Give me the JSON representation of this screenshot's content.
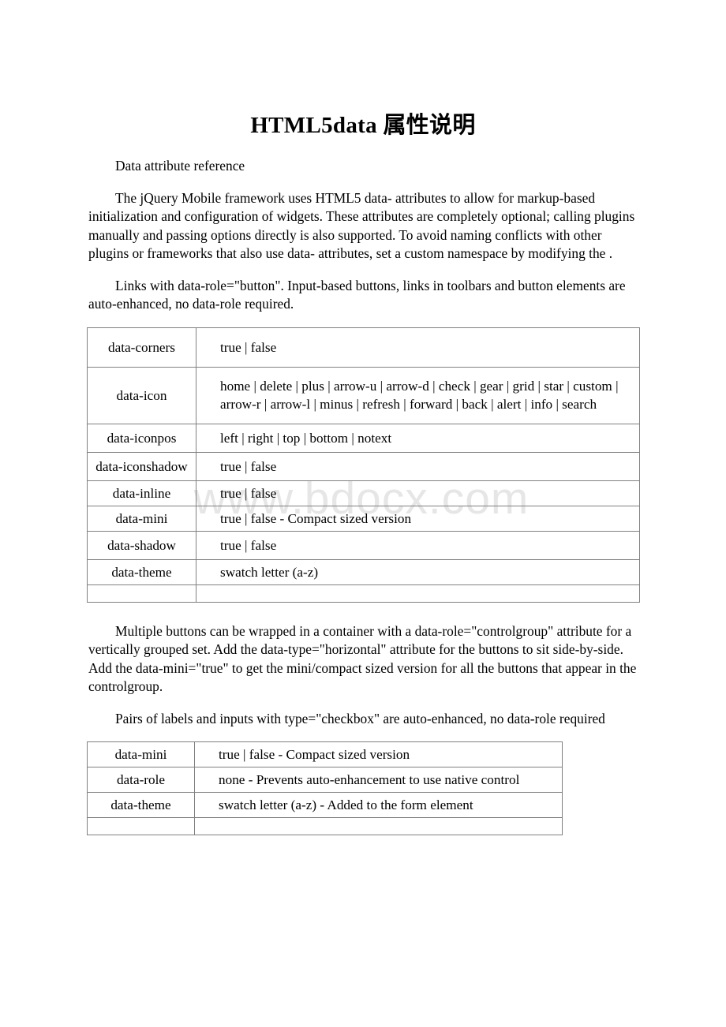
{
  "document": {
    "title": "HTML5data 属性说明",
    "watermark": "www.bdocx.com"
  },
  "sections": {
    "heading_ref": "Data attribute reference",
    "intro_paragraph": "The jQuery Mobile framework uses HTML5 data- attributes to allow for markup-based initialization and configuration of widgets. These attributes are completely optional; calling plugins manually and passing options directly is also supported. To avoid naming conflicts with other plugins or frameworks that also use data- attributes, set a custom namespace by modifying the .",
    "buttons_paragraph": "Links with data-role=\"button\". Input-based buttons, links in toolbars and button elements are auto-enhanced, no data-role required.",
    "controlgroup_paragraph": "Multiple buttons can be wrapped in a container with a data-role=\"controlgroup\" attribute for a vertically grouped set. Add the data-type=\"horizontal\" attribute for the buttons to sit side-by-side. Add the data-mini=\"true\" to get the mini/compact sized version for all the buttons that appear in the controlgroup.",
    "checkbox_paragraph": "Pairs of labels and inputs with type=\"checkbox\" are auto-enhanced, no data-role required"
  },
  "button_table": {
    "rows": [
      {
        "key": "data-corners",
        "value": "true | false"
      },
      {
        "key": "data-icon",
        "value": "home | delete | plus | arrow-u | arrow-d | check | gear | grid | star | custom | arrow-r | arrow-l | minus | refresh | forward | back | alert | info | search"
      },
      {
        "key": "data-iconpos",
        "value": "left | right | top | bottom | notext"
      },
      {
        "key": "data-iconshadow",
        "value": "true | false"
      },
      {
        "key": "data-inline",
        "value": "true | false"
      },
      {
        "key": "data-mini",
        "value": "true | false - Compact sized version"
      },
      {
        "key": "data-shadow",
        "value": "true | false"
      },
      {
        "key": "data-theme",
        "value": "swatch letter (a-z)"
      },
      {
        "key": "",
        "value": ""
      }
    ]
  },
  "checkbox_table": {
    "rows": [
      {
        "key": "data-mini",
        "value": "true | false - Compact sized version"
      },
      {
        "key": "data-role",
        "value": "none - Prevents auto-enhancement to use native control"
      },
      {
        "key": "data-theme",
        "value": "swatch letter (a-z) - Added to the form element"
      },
      {
        "key": "",
        "value": ""
      }
    ]
  },
  "colors": {
    "page_background": "#ffffff",
    "text": "#000000",
    "table_border": "#808080",
    "watermark": "#e6e6e6"
  }
}
